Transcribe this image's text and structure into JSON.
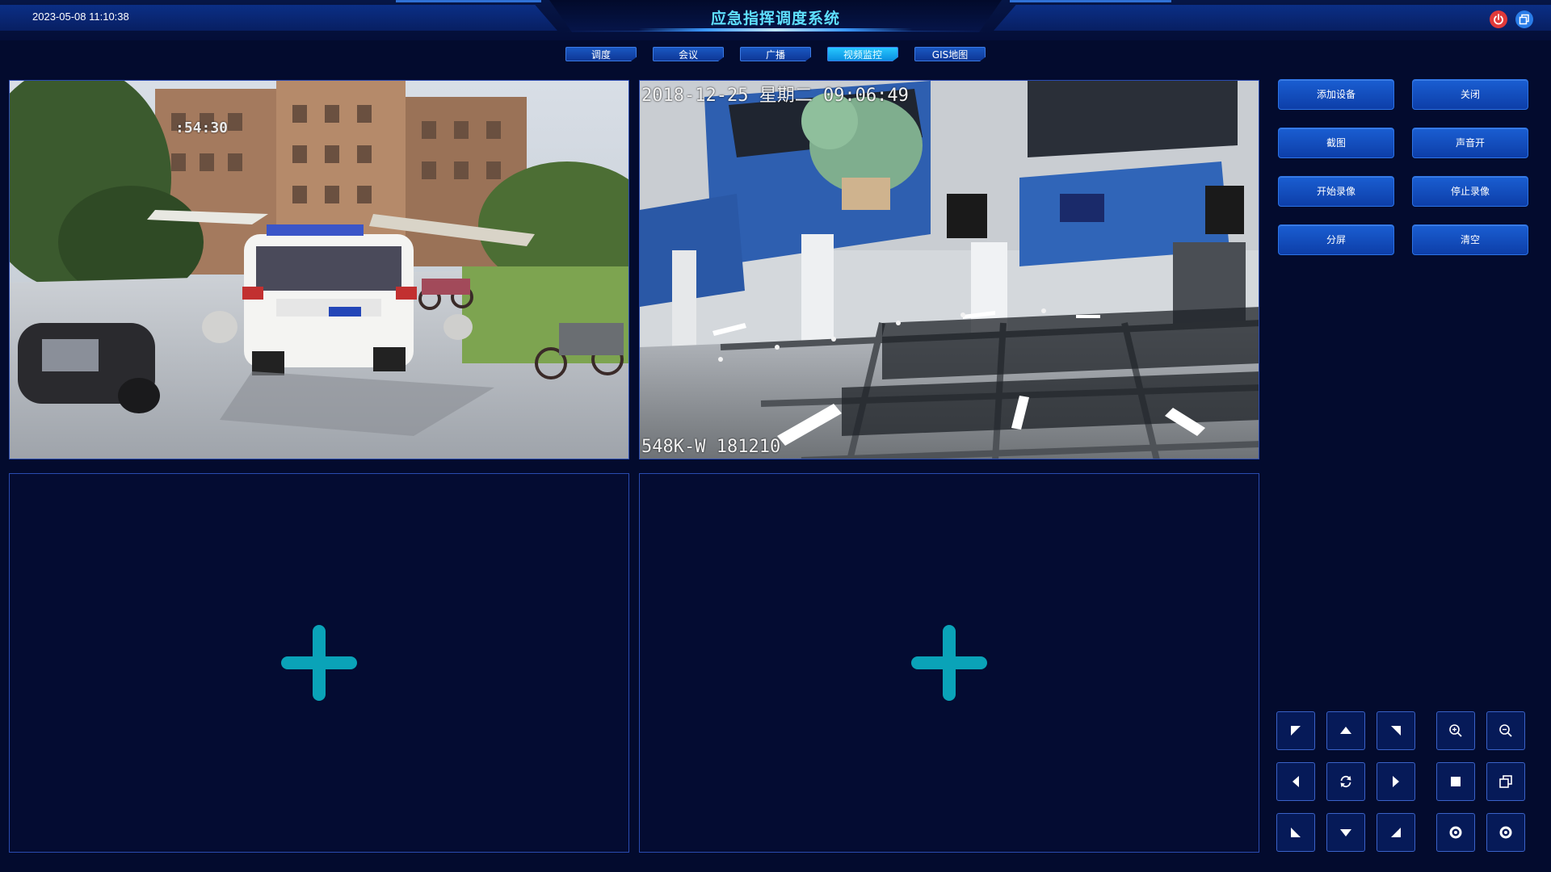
{
  "header": {
    "datetime": "2023-05-08 11:10:38",
    "title": "应急指挥调度系统",
    "power_icon": "power-icon",
    "window_icon": "window-icon"
  },
  "nav": {
    "tabs": [
      {
        "label": "调度",
        "active": false
      },
      {
        "label": "会议",
        "active": false
      },
      {
        "label": "广播",
        "active": false
      },
      {
        "label": "视频监控",
        "active": true
      },
      {
        "label": "GIS地图",
        "active": false
      }
    ]
  },
  "video": {
    "panel1": {
      "timestamp": ":54:30"
    },
    "panel2": {
      "timestamp": "2018-12-25 星期二 09:06:49",
      "camera": "548K-W    181210"
    },
    "panel3": {
      "icon": "add-icon"
    },
    "panel4": {
      "icon": "add-icon"
    }
  },
  "controls": {
    "add_device": "添加设备",
    "close": "关闭",
    "screenshot": "截图",
    "sound_on": "声音开",
    "start_record": "开始录像",
    "stop_record": "停止录像",
    "split_screen": "分屏",
    "clear": "清空"
  },
  "ptz": {
    "up_left": "arrow-up-left-icon",
    "up": "arrow-up-icon",
    "up_right": "arrow-up-right-icon",
    "zoom_in": "zoom-in-icon",
    "zoom_out": "zoom-out-icon",
    "left": "arrow-left-icon",
    "refresh": "refresh-icon",
    "right": "arrow-right-icon",
    "single": "single-screen-icon",
    "multi": "multi-window-icon",
    "down_left": "arrow-down-left-icon",
    "down": "arrow-down-icon",
    "down_right": "arrow-down-right-icon",
    "focus_near": "focus-near-icon",
    "focus_far": "focus-far-icon"
  },
  "colors": {
    "background": "#030b2e",
    "accent": "#5fe0ff",
    "button": "#1a5ed2",
    "active_tab": "#27c8ff",
    "plus": "#0aa3b8"
  }
}
